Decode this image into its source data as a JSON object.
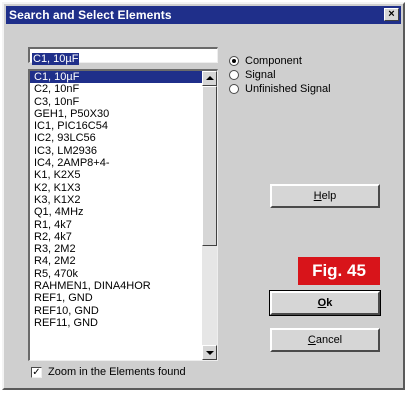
{
  "window": {
    "title": "Search and Select Elements",
    "close_label": "×"
  },
  "search": {
    "value": "C1, 10µF"
  },
  "list": {
    "items": [
      "C1, 10µF",
      "C2, 10nF",
      "C3, 10nF",
      "GEH1, P50X30",
      "IC1, PIC16C54",
      "IC2, 93LC56",
      "IC3, LM2936",
      "IC4, 2AMP8+4-",
      "K1, K2X5",
      "K2, K1X3",
      "K3, K1X2",
      "Q1, 4MHz",
      "R1, 4k7",
      "R2, 4k7",
      "R3, 2M2",
      "R4, 2M2",
      "R5, 470k",
      "RAHMEN1, DINA4HOR",
      "REF1, GND",
      "REF10, GND",
      "REF11, GND"
    ],
    "selected_index": 0
  },
  "radios": {
    "component": "Component",
    "signal": "Signal",
    "unfinished": "Unfinished Signal",
    "selected": "component"
  },
  "buttons": {
    "help_mnemonic": "H",
    "help_rest": "elp",
    "ok_mnemonic": "O",
    "ok_rest": "k",
    "cancel_mnemonic": "C",
    "cancel_rest": "ancel"
  },
  "badge": {
    "text": "Fig. 45"
  },
  "zoom_checkbox": {
    "label": "Zoom in the Elements found",
    "checked": true,
    "mark": "✓"
  },
  "colors": {
    "title_bar": "#1f2f8a",
    "dialog_bg": "#cfcfcf",
    "badge": "#d8141a",
    "selection": "#1f2f8a"
  }
}
